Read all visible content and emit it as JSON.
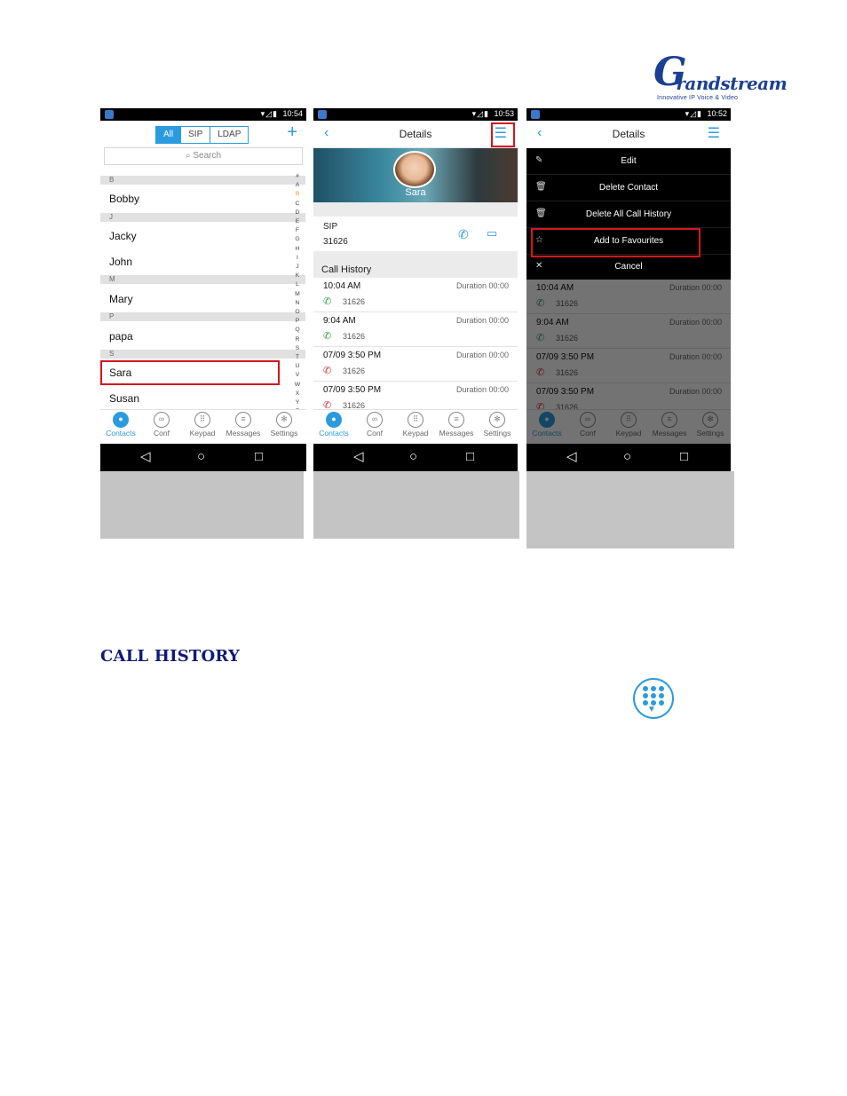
{
  "logo": {
    "brand": "Grandstream",
    "tagline": "Innovative IP Voice & Video"
  },
  "phones": [
    {
      "time": "10:54",
      "filters": [
        "All",
        "SIP",
        "LDAP"
      ],
      "plus": "+",
      "search_placeholder": "Search",
      "contacts": [
        {
          "section": "B",
          "name": "Bobby"
        },
        {
          "section": "J",
          "name": "Jacky"
        },
        {
          "section": "",
          "name": "John"
        },
        {
          "section": "M",
          "name": "Mary"
        },
        {
          "section": "P",
          "name": "papa"
        },
        {
          "section": "S",
          "name": "Sara"
        },
        {
          "section": "",
          "name": "Susan"
        }
      ],
      "alphabet": [
        "#",
        "A",
        "B",
        "C",
        "D",
        "E",
        "F",
        "G",
        "H",
        "I",
        "J",
        "K",
        "L",
        "M",
        "N",
        "O",
        "P",
        "Q",
        "R",
        "S",
        "T",
        "U",
        "V",
        "W",
        "X",
        "Y",
        "Z"
      ]
    },
    {
      "time": "10:53",
      "title": "Details",
      "contact_name": "Sara",
      "account_type": "SIP",
      "number": "31626",
      "call_history_label": "Call History"
    },
    {
      "time": "10:52",
      "title": "Details",
      "menu": [
        "Edit",
        "Delete Contact",
        "Delete All Call History",
        "Add to Favourites",
        "Cancel"
      ]
    }
  ],
  "calls": [
    {
      "time": "10:04 AM",
      "duration": "Duration 00:00",
      "number": "31626",
      "type": "incoming"
    },
    {
      "time": "9:04 AM",
      "duration": "Duration 00:00",
      "number": "31626",
      "type": "incoming"
    },
    {
      "time": "07/09 3:50 PM",
      "duration": "Duration 00:00",
      "number": "31626",
      "type": "missed"
    },
    {
      "time": "07/09 3:50 PM",
      "duration": "Duration 00:00",
      "number": "31626",
      "type": "missed"
    }
  ],
  "tabs": [
    "Contacts",
    "Conf",
    "Keypad",
    "Messages",
    "Settings"
  ],
  "section_heading": "CALL HISTORY",
  "colors": {
    "accent": "#2a9be0",
    "highlight": "#d8141c",
    "heading": "#111a7a"
  }
}
